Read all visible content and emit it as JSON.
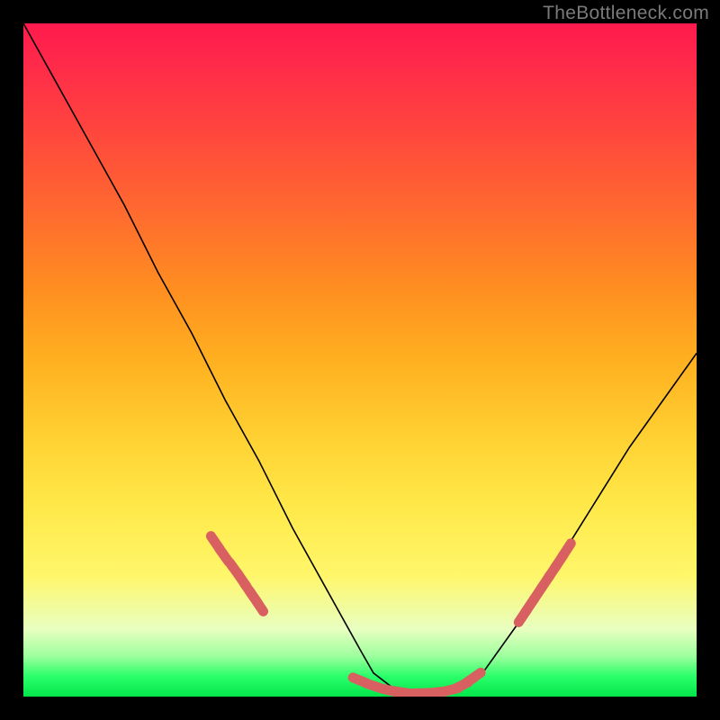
{
  "watermark": {
    "text": "TheBottleneck.com"
  },
  "colors": {
    "curve": "#000000",
    "marker": "#d96060",
    "background_black": "#000000"
  },
  "chart_data": {
    "type": "line",
    "title": "",
    "xlabel": "",
    "ylabel": "",
    "xlim": [
      0,
      100
    ],
    "ylim": [
      0,
      100
    ],
    "grid": false,
    "legend": false,
    "series": [
      {
        "name": "bottleneck-curve",
        "x": [
          0,
          5,
          10,
          15,
          20,
          25,
          30,
          35,
          40,
          45,
          50,
          52,
          55,
          58,
          60,
          63,
          65,
          68,
          70,
          75,
          80,
          85,
          90,
          95,
          100
        ],
        "y": [
          100,
          91,
          82,
          73,
          63,
          54,
          44,
          35,
          25,
          16,
          7,
          3.5,
          1.2,
          0.4,
          0.2,
          0.4,
          1.2,
          3.2,
          6,
          13,
          21,
          29,
          37,
          44,
          51
        ]
      }
    ],
    "annotations": [
      {
        "name": "left-marker-cluster",
        "type": "points",
        "x": [
          28.5,
          29.8,
          31.3,
          32.5,
          33.5,
          34.2,
          35.0
        ],
        "y": [
          22.9,
          21.0,
          19.0,
          17.3,
          15.8,
          14.8,
          13.6
        ]
      },
      {
        "name": "valley-marker-cluster",
        "type": "points",
        "x": [
          50.0,
          52.0,
          54.5,
          55.8,
          57.0,
          59.0,
          61.0,
          63.5,
          65.0,
          66.0,
          67.0
        ],
        "y": [
          2.4,
          1.6,
          0.9,
          0.7,
          0.5,
          0.5,
          0.6,
          1.0,
          1.6,
          2.2,
          2.9
        ]
      },
      {
        "name": "right-marker-cluster",
        "type": "points",
        "x": [
          74.2,
          75.2,
          76.4,
          77.6,
          78.6,
          79.6,
          80.7
        ],
        "y": [
          12.0,
          13.5,
          15.3,
          17.1,
          18.6,
          20.1,
          21.8
        ]
      }
    ]
  }
}
